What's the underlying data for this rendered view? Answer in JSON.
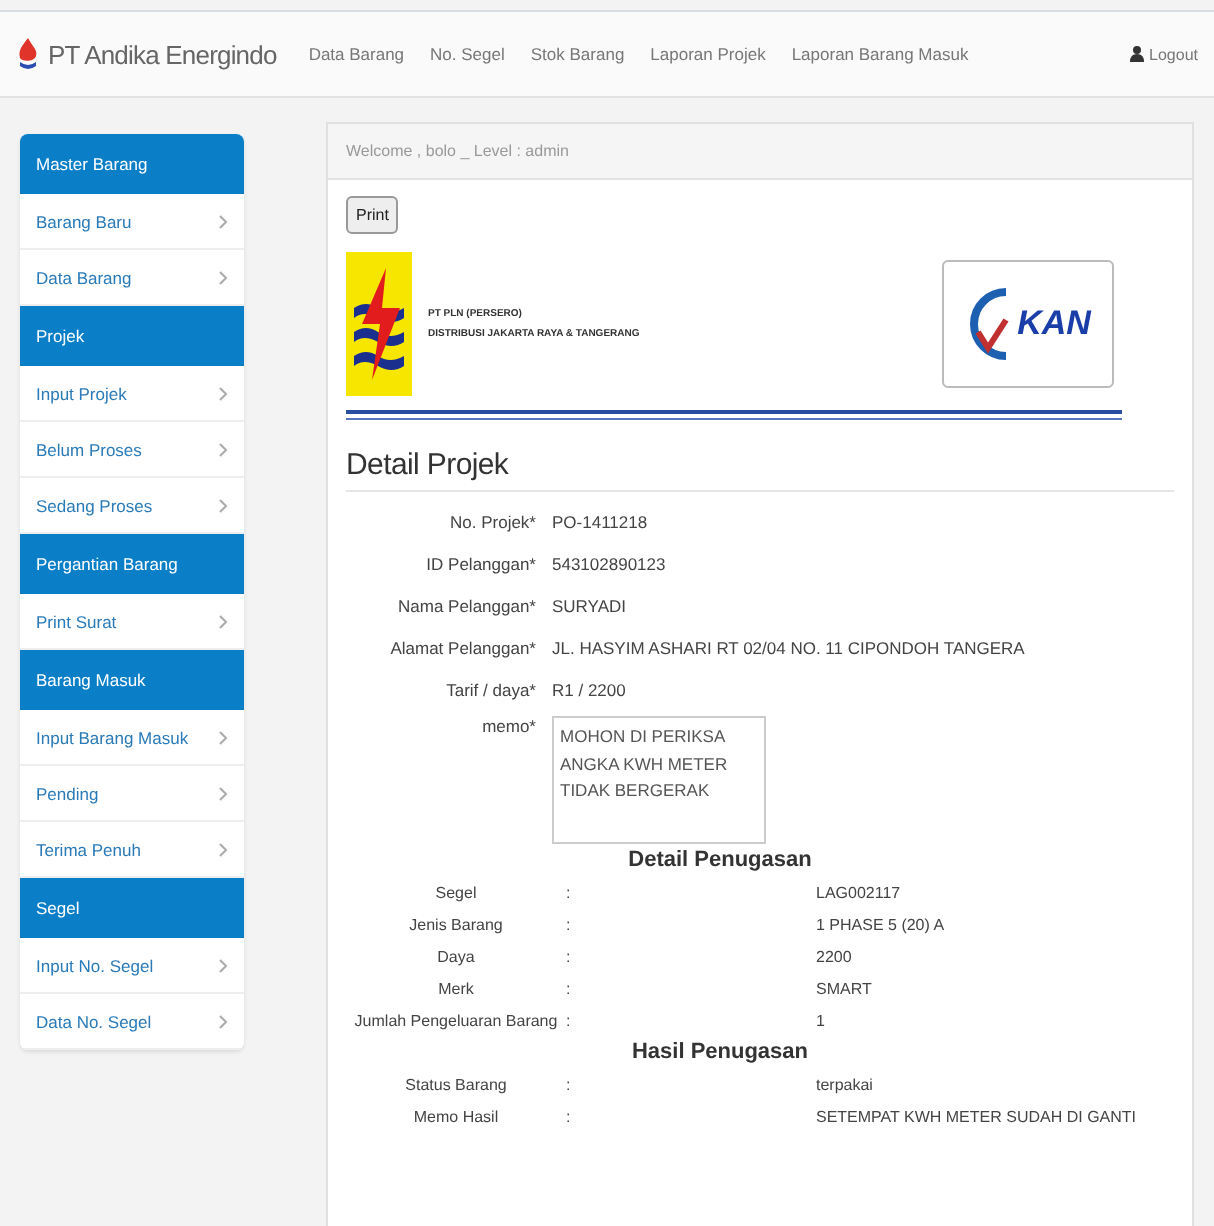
{
  "navbar": {
    "brand": "PT Andika Energindo",
    "links": [
      "Data Barang",
      "No. Segel",
      "Stok Barang",
      "Laporan Projek",
      "Laporan Barang Masuk"
    ],
    "logout": "Logout"
  },
  "sidebar": {
    "sections": [
      {
        "title": "Master Barang",
        "items": [
          "Barang Baru",
          "Data Barang"
        ]
      },
      {
        "title": "Projek",
        "items": [
          "Input Projek",
          "Belum Proses",
          "Sedang Proses"
        ]
      },
      {
        "title": "Pergantian Barang",
        "items": [
          "Print Surat"
        ]
      },
      {
        "title": "Barang Masuk",
        "items": [
          "Input Barang Masuk",
          "Pending",
          "Terima Penuh"
        ]
      },
      {
        "title": "Segel",
        "items": [
          "Input No. Segel",
          "Data No. Segel"
        ]
      }
    ]
  },
  "welcome": "Welcome , bolo _ Level : admin",
  "print_button": "Print",
  "letterhead": {
    "company": "PT PLN (PERSERO)",
    "division": "DISTRIBUSI JAKARTA RAYA & TANGERANG",
    "badge": "KAN"
  },
  "heading": "Detail Projek",
  "fields": [
    {
      "label": "No. Projek*",
      "value": "PO-1411218"
    },
    {
      "label": "ID Pelanggan*",
      "value": "543102890123"
    },
    {
      "label": "Nama Pelanggan*",
      "value": "SURYADI"
    },
    {
      "label": "Alamat Pelanggan*",
      "value": "JL. HASYIM ASHARI RT 02/04 NO. 11 CIPONDOH TANGERA"
    },
    {
      "label": "Tarif / daya*",
      "value": "R1 / 2200"
    }
  ],
  "memo": {
    "label": "memo*",
    "value": "MOHON DI PERIKSA ANGKA KWH METER TIDAK BERGERAK"
  },
  "tables": [
    {
      "title": "Detail Penugasan",
      "rows": [
        {
          "label": "Segel",
          "sep": ":",
          "value": "LAG002117"
        },
        {
          "label": "Jenis Barang",
          "sep": ":",
          "value": "1 PHASE 5 (20) A"
        },
        {
          "label": "Daya",
          "sep": ":",
          "value": "2200"
        },
        {
          "label": "Merk",
          "sep": ":",
          "value": "SMART"
        },
        {
          "label": "Jumlah Pengeluaran Barang",
          "sep": ":",
          "value": "1"
        }
      ]
    },
    {
      "title": "Hasil Penugasan",
      "rows": [
        {
          "label": "Status Barang",
          "sep": ":",
          "value": "terpakai"
        },
        {
          "label": "Memo Hasil",
          "sep": ":",
          "value": "SETEMPAT KWH METER SUDAH DI GANTI"
        }
      ]
    }
  ]
}
